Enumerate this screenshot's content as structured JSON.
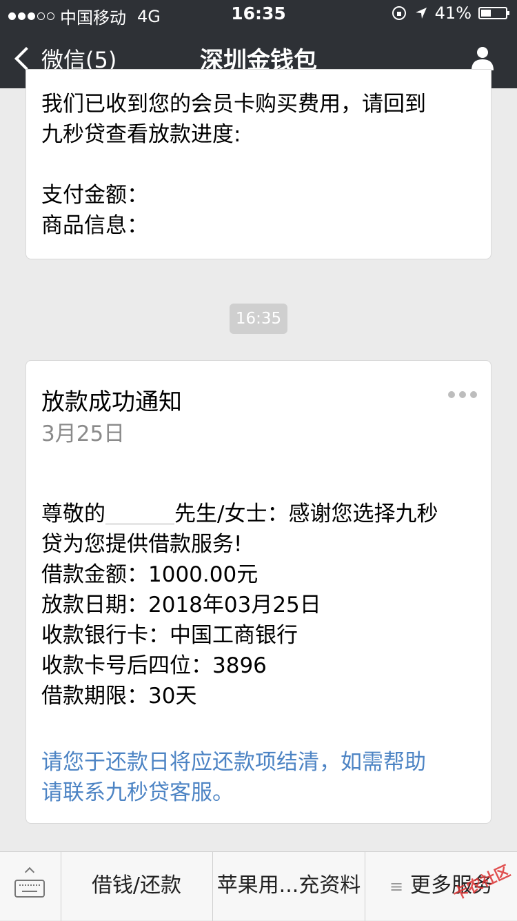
{
  "status_bar": {
    "carrier": "中国移动",
    "network": "4G",
    "time": "16:35",
    "battery_text": "41%",
    "battery_level": 0.41
  },
  "nav": {
    "back_label": "微信(5)",
    "title": "深圳金钱包"
  },
  "messages": {
    "first": {
      "line1": "我们已收到您的会员卡购买费用，请回到",
      "line2": "九秒贷查看放款进度:",
      "line3": "支付金额：",
      "line4": "商品信息："
    },
    "timestamp": "16:35",
    "notice": {
      "title": "放款成功通知",
      "date": "3月25日",
      "greeting_prefix": "尊敬的",
      "greeting_suffix": "先生/女士：感谢您选择九秒",
      "line2": "贷为您提供借款服务!",
      "amount": "借款金额：1000.00元",
      "date_line": "放款日期：2018年03月25日",
      "bank": "收款银行卡：中国工商银行",
      "card_last4": "收款卡号后四位：3896",
      "term": "借款期限：30天",
      "note_line1": "请您于还款日将应还款项结清，如需帮助",
      "note_line2": "请联系九秒贷客服。"
    }
  },
  "bottom_menu": {
    "item1": "借钱/还款",
    "item2": "苹果用...充资料",
    "item3": "更多服务"
  },
  "watermark": "卡农社区",
  "colors": {
    "nav_bg": "#2e3136",
    "link_blue": "#4d84c4"
  }
}
